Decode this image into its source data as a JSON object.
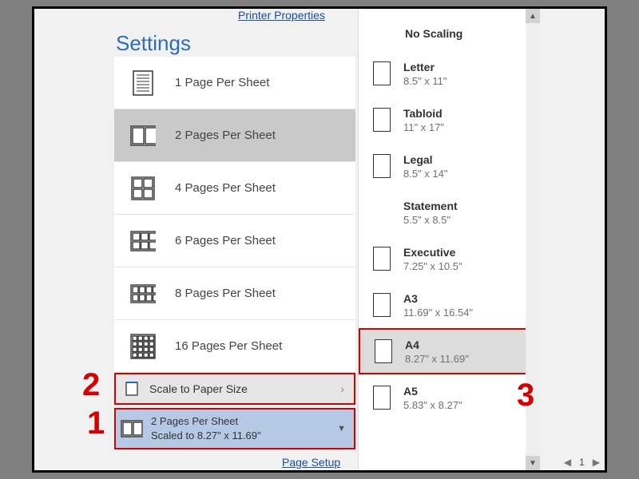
{
  "top_link": "Printer Properties",
  "settings_heading": "Settings",
  "pages_per_sheet": [
    {
      "label": "1 Page Per Sheet",
      "selected": false
    },
    {
      "label": "2 Pages Per Sheet",
      "selected": true
    },
    {
      "label": "4 Pages Per Sheet",
      "selected": false
    },
    {
      "label": "6 Pages Per Sheet",
      "selected": false
    },
    {
      "label": "8 Pages Per Sheet",
      "selected": false
    },
    {
      "label": "16 Pages Per Sheet",
      "selected": false
    }
  ],
  "scale_row": {
    "label": "Scale to Paper Size"
  },
  "current_setting": {
    "line1": "2 Pages Per Sheet",
    "line2": "Scaled to 8.27\" x 11.69\""
  },
  "page_setup_link": "Page Setup",
  "paper_header": "No Scaling",
  "paper_sizes": [
    {
      "name": "Letter",
      "dim": "8.5\" x 11\"",
      "icon": true
    },
    {
      "name": "Tabloid",
      "dim": "11\" x 17\"",
      "icon": true
    },
    {
      "name": "Legal",
      "dim": "8.5\" x 14\"",
      "icon": true
    },
    {
      "name": "Statement",
      "dim": "5.5\" x 8.5\"",
      "icon": false
    },
    {
      "name": "Executive",
      "dim": "7.25\" x 10.5\"",
      "icon": true
    },
    {
      "name": "A3",
      "dim": "11.69\" x 16.54\"",
      "icon": true
    },
    {
      "name": "A4",
      "dim": "8.27\" x 11.69\"",
      "icon": true,
      "selected": true
    },
    {
      "name": "A5",
      "dim": "5.83\" x 8.27\"",
      "icon": true
    }
  ],
  "page_nav": {
    "current": "1"
  },
  "callouts": {
    "n1": "1",
    "n2": "2",
    "n3": "3"
  }
}
